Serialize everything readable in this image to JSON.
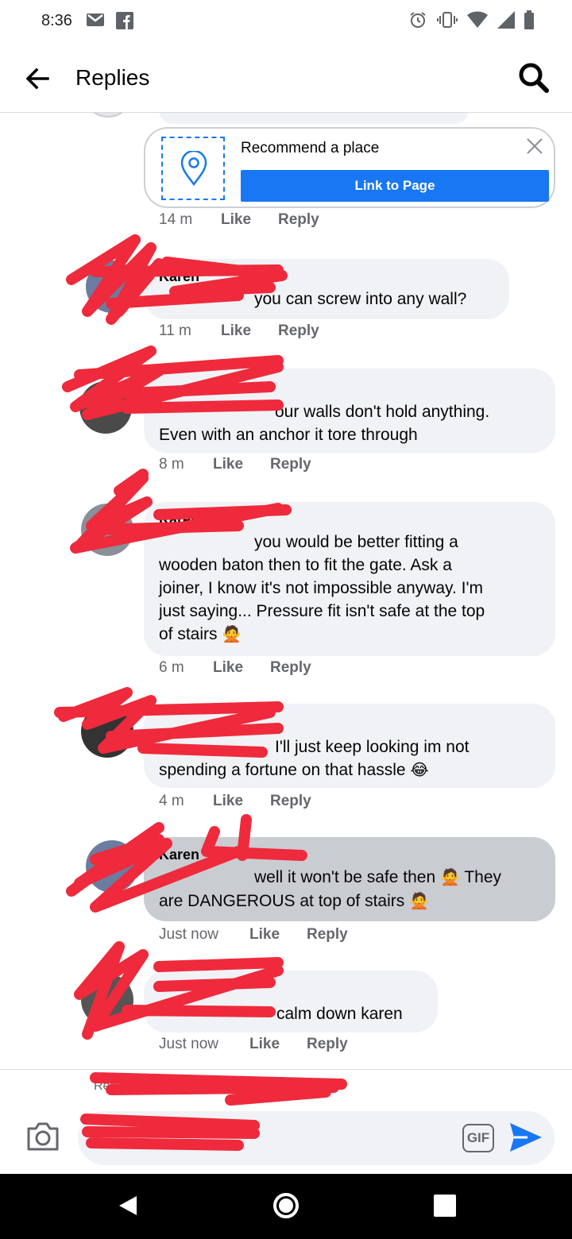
{
  "status": {
    "time": "8:36"
  },
  "header": {
    "title": "Replies"
  },
  "place_card": {
    "label": "Recommend a place",
    "button": "Link to Page"
  },
  "comments": [
    {
      "time": "14 m",
      "like": "Like",
      "reply": "Reply"
    },
    {
      "author": "Karen",
      "text": "you can screw into any wall?",
      "time": "11 m",
      "like": "Like",
      "reply": "Reply"
    },
    {
      "text1": "our walls don't hold anything.",
      "text2": "Even with an anchor it tore through",
      "time": "8 m",
      "like": "Like",
      "reply": "Reply"
    },
    {
      "author": "Karen",
      "line1": "you would be better fitting a",
      "line2": "wooden baton then to fit the gate. Ask a",
      "line3": "joiner, I know it's not impossible anyway. I'm",
      "line4": "just saying... Pressure fit isn't safe at the top",
      "line5": "of stairs",
      "time": "6 m",
      "like": "Like",
      "reply": "Reply"
    },
    {
      "line1": "I'll just keep looking im not",
      "line2": "spending a fortune on that hassle",
      "time": "4 m",
      "like": "Like",
      "reply": "Reply"
    },
    {
      "author": "Karen",
      "line1": "well it won't be safe then",
      "line1b": "They",
      "line2": "are DANGEROUS at top of stairs",
      "time": "Just now",
      "like": "Like",
      "reply": "Reply"
    },
    {
      "text": "calm down karen",
      "time": "Just now",
      "like": "Like",
      "reply": "Reply"
    }
  ],
  "composer": {
    "replying": "Replying to",
    "gif": "GIF"
  },
  "icons": {
    "accent": "#1877f2",
    "redaction": "#ee2a3c"
  }
}
